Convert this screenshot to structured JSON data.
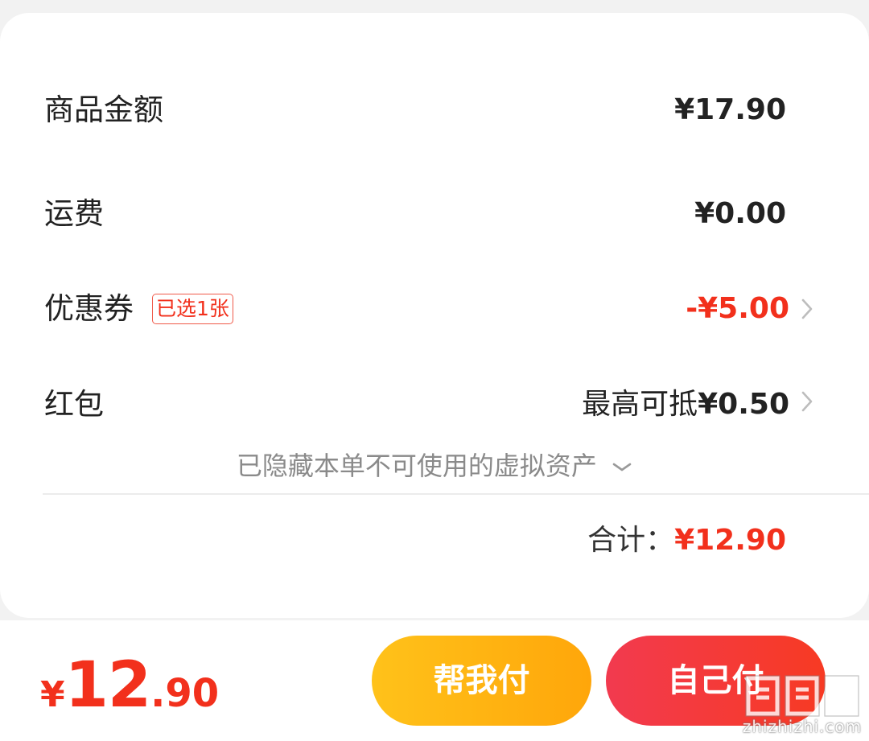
{
  "summary": {
    "goods_label": "商品金额",
    "goods_value": "¥17.90",
    "shipping_label": "运费",
    "shipping_value": "¥0.00",
    "coupon_label": "优惠券",
    "coupon_badge": "已选1张",
    "coupon_value": "-¥5.00",
    "redpacket_label": "红包",
    "redpacket_prefix": "最高可抵",
    "redpacket_value": "¥0.50",
    "hidden_note": "已隐藏本单不可使用的虚拟资产",
    "total_label": "合计：",
    "total_value": "¥12.90"
  },
  "footer": {
    "currency": "¥",
    "price_int": "12",
    "price_dec": ".90",
    "help_pay_label": "帮我付",
    "self_pay_label": "自己付"
  },
  "watermark": {
    "text": "zhizhizhi.com",
    "logo_icon": "zhi-logo-icon"
  },
  "colors": {
    "accent_red": "#f2301c",
    "help_button": "#ffb312",
    "self_button": "#f5363a"
  },
  "icons": [
    "chevron-right-icon",
    "chevron-down-icon"
  ]
}
